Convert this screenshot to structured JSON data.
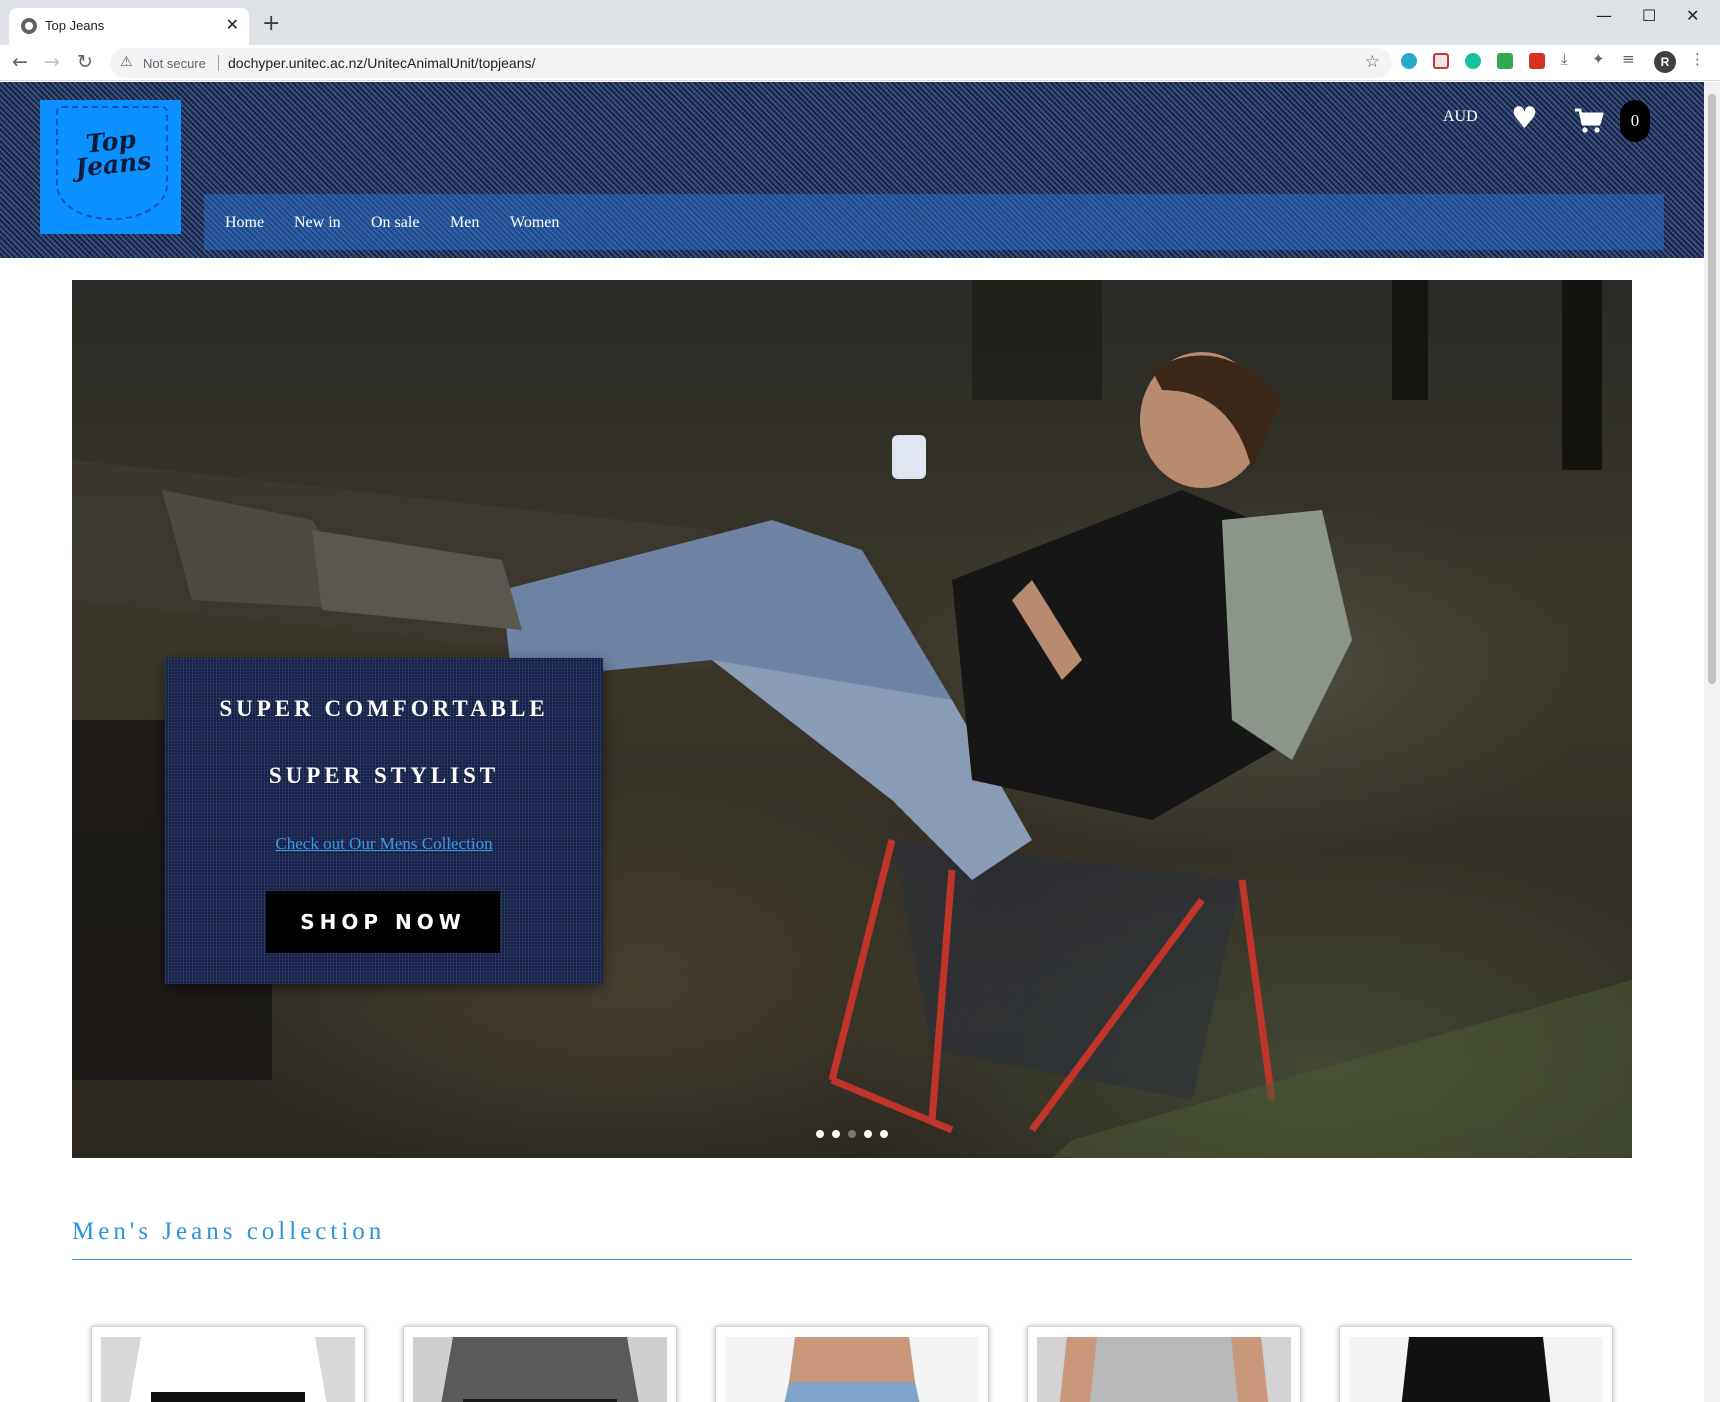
{
  "browser": {
    "tab_title": "Top Jeans",
    "tab_close": "✕",
    "new_tab": "+",
    "security_label": "Not secure",
    "url": "dochyper.unitec.ac.nz/UnitecAnimalUnit/topjeans/",
    "profile_initial": "R",
    "window_controls": {
      "minimize": "—",
      "maximize": "☐",
      "close": "✕"
    },
    "nav_icons": {
      "back": "←",
      "forward": "→",
      "reload": "↻",
      "star": "☆",
      "warning": "⚠"
    }
  },
  "site": {
    "logo_text": "Top Jeans",
    "nav": [
      "Home",
      "New in",
      "On sale",
      "Men",
      "Women"
    ],
    "currency": "AUD",
    "wishlist_icon": "♥",
    "cart_count": "0"
  },
  "hero": {
    "headline_1": "SUPER COMFORTABLE",
    "headline_2": "SUPER STYLIST",
    "link_text": "Check out Our Mens Collection",
    "button_label": "SHOP NOW",
    "slide_count": 5
  },
  "section": {
    "title": "Men's Jeans collection"
  },
  "products": [
    {
      "name": "product-white-tee"
    },
    {
      "name": "product-grey-tee"
    },
    {
      "name": "product-shirtless"
    },
    {
      "name": "product-light-grey-tee"
    },
    {
      "name": "product-black-tee"
    }
  ],
  "colors": {
    "accent": "#2b95d6",
    "logo_bg": "#0a90ff",
    "header_denim": "#1d2a4f",
    "button_bg": "#000000"
  }
}
